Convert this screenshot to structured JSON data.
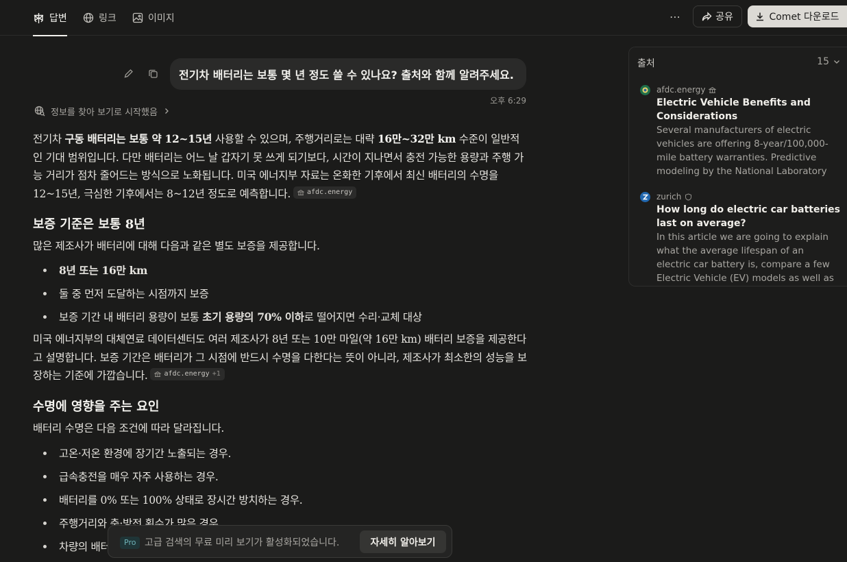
{
  "tabs": [
    {
      "label": "답변",
      "active": true
    },
    {
      "label": "링크",
      "active": false
    },
    {
      "label": "이미지",
      "active": false
    }
  ],
  "header": {
    "more_label": "⋯",
    "share_label": "공유",
    "download_label": "Comet 다운로드"
  },
  "question": {
    "text": "전기차 배터리는 보통 몇 년 정도 쓸 수 있나요? 출처와 함께 알려주세요.",
    "time": "오후 6:29"
  },
  "steps_label": "정보를 찾아 보기로 시작했음",
  "answer": {
    "p1": {
      "s1": "전기차 ",
      "b1": "구동 배터리는 보통 약 12~15년",
      "s2": " 사용할 수 있으며, 주행거리로는 대략 ",
      "b2": "16만~32만 km",
      "s3": " 수준이 일반적인 기대 범위입니다. 다만 배터리는 어느 날 갑자기 못 쓰게 되기보다, 시간이 지나면서 충전 가능한 용량과 주행 가능 거리가 점차 줄어드는 방식으로 노화됩니다. 미국 에너지부 자료는 온화한 기후에서 최신 배터리의 수명을 12~15년, 극심한 기후에서는 8~12년 정도로 예측합니다.",
      "cite": "afdc.energy"
    },
    "h1": "보증 기준은 보통 8년",
    "p2": "많은 제조사가 배터리에 대해 다음과 같은 별도 보증을 제공합니다.",
    "list1": {
      "item1": "8년 또는 16만 km",
      "item2": "둘 중 먼저 도달하는 시점까지 보증",
      "item3_a": "보증 기간 내 배터리 용량이 보통 ",
      "item3_b": "초기 용량의 70% 이하",
      "item3_c": "로 떨어지면 수리·교체 대상"
    },
    "p3": {
      "text": "미국 에너지부의 대체연료 데이터센터도 여러 제조사가 8년 또는 10만 마일(약 16만 km) 배터리 보증을 제공한다고 설명합니다. 보증 기간은 배터리가 그 시점에 반드시 수명을 다한다는 뜻이 아니라, 제조사가 최소한의 성능을 보장하는 기준에 가깝습니다.",
      "cite": "afdc.energy",
      "cite_more": "+1"
    },
    "h2": "수명에 영향을 주는 요인",
    "p4": "배터리 수명은 다음 조건에 따라 달라집니다.",
    "list2": [
      "고온·저온 환경에 장기간 노출되는 경우.",
      "급속충전을 매우 자주 사용하는 경우.",
      "배터리를 0% 또는 100% 상태로 장시간 방치하는 경우.",
      "주행거리와 충·방전 횟수가 많은 경우.",
      "차량의 배터리 관리 시스템과 냉각 방식."
    ]
  },
  "sources": {
    "title": "출처",
    "count": "15",
    "items": [
      {
        "domain": "afdc.energy",
        "title": "Electric Vehicle Benefits and Considerations",
        "desc": "Several manufacturers of electric vehicles are offering 8-year/100,000-mile battery warranties. Predictive modeling by the National Laboratory of…"
      },
      {
        "domain": "zurich",
        "title": "How long do electric car batteries last on average?",
        "desc": "In this article we are going to explain what the average lifespan of an electric car battery is, compare a few Electric Vehicle (EV) models as well as explore…"
      }
    ]
  },
  "toast": {
    "badge": "Pro",
    "text": "고급 검색의 무료 미리 보기가 활성화되었습니다.",
    "button": "자세히 알아보기"
  }
}
